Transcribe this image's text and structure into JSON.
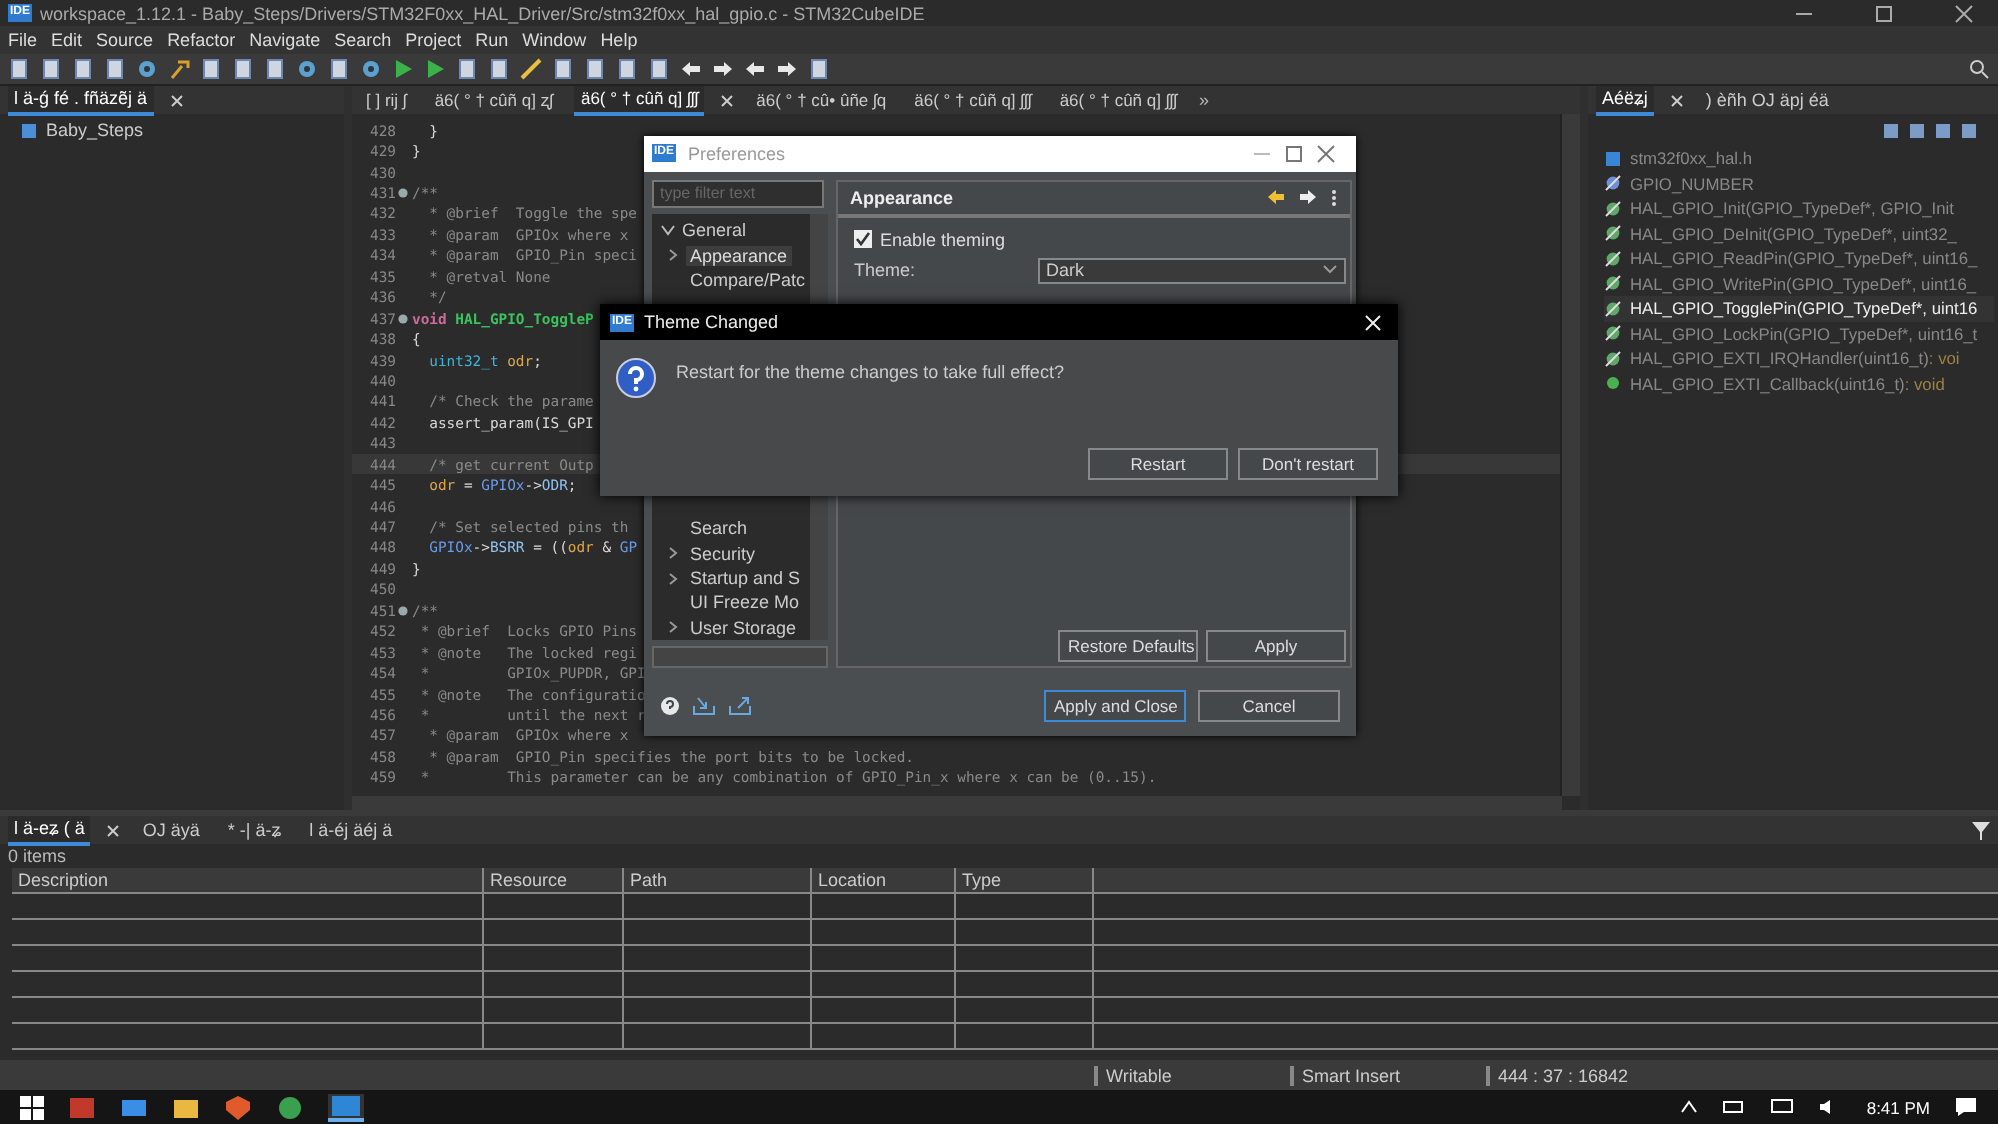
{
  "window": {
    "logo": "IDE",
    "title": "workspace_1.12.1 - Baby_Steps/Drivers/STM32F0xx_HAL_Driver/Src/stm32f0xx_hal_gpio.c - STM32CubeIDE"
  },
  "menu": [
    "File",
    "Edit",
    "Source",
    "Refactor",
    "Navigate",
    "Search",
    "Project",
    "Run",
    "Window",
    "Help"
  ],
  "left_panel": {
    "tabs": [
      {
        "label": "l ä-ǵ fé . fñäzẽj ä",
        "selected": true
      }
    ],
    "items": [
      {
        "label": "Baby_Steps"
      }
    ]
  },
  "editor": {
    "tabs": [
      {
        "label": "[ ] rĳ ʃ",
        "selected": false
      },
      {
        "label": "ä6( ° † cûñ q] ʐʃ",
        "selected": false
      },
      {
        "label": "ä6( ° † cûñ q] ʃʃʃ",
        "selected": true
      },
      {
        "label": "ä6( ° † cû• ûñe ʃq",
        "selected": false
      },
      {
        "label": "ä6( ° † cûñ q] ʃʃʃ",
        "selected": false
      },
      {
        "label": "ä6( ° † cûñ q] ʃʃʃ",
        "selected": false
      }
    ],
    "overflow": "»",
    "lines": [
      {
        "number": "428",
        "fold": false,
        "current": false,
        "segments": [
          {
            "kind": "plain",
            "text": "  }"
          }
        ]
      },
      {
        "number": "429",
        "fold": false,
        "current": false,
        "segments": [
          {
            "kind": "plain",
            "text": "}"
          }
        ]
      },
      {
        "number": "430",
        "fold": false,
        "current": false
      },
      {
        "number": "431",
        "fold": true,
        "current": false,
        "segments": [
          {
            "kind": "comment",
            "text": "/**"
          }
        ]
      },
      {
        "number": "432",
        "fold": false,
        "current": false,
        "segments": [
          {
            "kind": "comment",
            "text": "  * @brief  Toggle the spe"
          }
        ]
      },
      {
        "number": "433",
        "fold": false,
        "current": false,
        "segments": [
          {
            "kind": "comment",
            "text": "  * @param  GPIOx where x"
          }
        ]
      },
      {
        "number": "434",
        "fold": false,
        "current": false,
        "segments": [
          {
            "kind": "comment",
            "text": "  * @param  GPIO_Pin speci"
          }
        ]
      },
      {
        "number": "435",
        "fold": false,
        "current": false,
        "segments": [
          {
            "kind": "comment",
            "text": "  * @retval None"
          }
        ]
      },
      {
        "number": "436",
        "fold": false,
        "current": false,
        "segments": [
          {
            "kind": "comment",
            "text": "  */"
          }
        ]
      },
      {
        "number": "437",
        "fold": true,
        "current": false,
        "segments": [
          {
            "kind": "keyword",
            "text": "void"
          },
          {
            "kind": "function",
            "text": " HAL_GPIO_ToggleP"
          }
        ]
      },
      {
        "number": "438",
        "fold": false,
        "current": false,
        "segments": [
          {
            "kind": "plain",
            "text": "{"
          }
        ]
      },
      {
        "number": "439",
        "fold": false,
        "current": false,
        "segments": [
          {
            "kind": "type",
            "text": "  uint32_t"
          },
          {
            "kind": "variable",
            "text": " odr"
          },
          {
            "kind": "plain",
            "text": ";"
          }
        ]
      },
      {
        "number": "440",
        "fold": false,
        "current": false
      },
      {
        "number": "441",
        "fold": false,
        "current": false,
        "segments": [
          {
            "kind": "comment",
            "text": "  /* Check the parame"
          }
        ]
      },
      {
        "number": "442",
        "fold": false,
        "current": false,
        "segments": [
          {
            "kind": "plain",
            "text": "  assert_param(IS_GPI"
          }
        ]
      },
      {
        "number": "443",
        "fold": false,
        "current": false
      },
      {
        "number": "444",
        "fold": false,
        "current": true,
        "segments": [
          {
            "kind": "comment",
            "text": "  /* get current Outp"
          }
        ]
      },
      {
        "number": "445",
        "fold": false,
        "current": false,
        "segments": [
          {
            "kind": "variable",
            "text": "  odr"
          },
          {
            "kind": "plain",
            "text": " = "
          },
          {
            "kind": "param",
            "text": "GPIOx"
          },
          {
            "kind": "plain",
            "text": "->"
          },
          {
            "kind": "field",
            "text": "ODR"
          },
          {
            "kind": "plain",
            "text": ";"
          }
        ]
      },
      {
        "number": "446",
        "fold": false,
        "current": false
      },
      {
        "number": "447",
        "fold": false,
        "current": false,
        "segments": [
          {
            "kind": "comment",
            "text": "  /* Set selected pins th"
          }
        ]
      },
      {
        "number": "448",
        "fold": false,
        "current": false,
        "segments": [
          {
            "kind": "param",
            "text": "  GPIOx"
          },
          {
            "kind": "plain",
            "text": "->"
          },
          {
            "kind": "field",
            "text": "BSRR"
          },
          {
            "kind": "plain",
            "text": " = (("
          },
          {
            "kind": "variable",
            "text": "odr"
          },
          {
            "kind": "plain",
            "text": " & "
          },
          {
            "kind": "param",
            "text": "GP"
          }
        ]
      },
      {
        "number": "449",
        "fold": false,
        "current": false,
        "segments": [
          {
            "kind": "plain",
            "text": "}"
          }
        ]
      },
      {
        "number": "450",
        "fold": false,
        "current": false
      },
      {
        "number": "451",
        "fold": true,
        "current": false,
        "segments": [
          {
            "kind": "comment",
            "text": "/**"
          }
        ]
      },
      {
        "number": "452",
        "fold": false,
        "current": false,
        "segments": [
          {
            "kind": "comment",
            "text": " * @brief  Locks GPIO Pins"
          }
        ]
      },
      {
        "number": "453",
        "fold": false,
        "current": false,
        "segments": [
          {
            "kind": "comment",
            "text": " * @note   The locked regi"
          }
        ]
      },
      {
        "number": "454",
        "fold": false,
        "current": false,
        "segments": [
          {
            "kind": "comment",
            "text": " *         GPIOx_PUPDR, GPI"
          }
        ]
      },
      {
        "number": "455",
        "fold": false,
        "current": false,
        "segments": [
          {
            "kind": "comment",
            "text": " * @note   The configuratio"
          }
        ]
      },
      {
        "number": "456",
        "fold": false,
        "current": false,
        "segments": [
          {
            "kind": "comment",
            "text": " *         until the next r"
          }
        ]
      },
      {
        "number": "457",
        "fold": false,
        "current": false,
        "segments": [
          {
            "kind": "comment",
            "text": "  * @param  GPIOx where x"
          }
        ]
      },
      {
        "number": "458",
        "fold": false,
        "current": false,
        "segments": [
          {
            "kind": "comment",
            "text": "  * @param  GPIO_Pin specifies the port bits to be locked."
          }
        ]
      },
      {
        "number": "459",
        "fold": false,
        "current": false,
        "segments": [
          {
            "kind": "comment",
            "text": " *         This parameter can be any combination of GPIO_Pin_x where x can be (0..15)."
          }
        ]
      }
    ]
  },
  "outline": {
    "tabs": [
      {
        "label": "Aéëʑj",
        "selected": true
      },
      {
        "label": ") èñh OJ äpj éä",
        "selected": false
      }
    ],
    "items": [
      {
        "kind": "include",
        "label": "stm32f0xx_hal.h",
        "selected": false
      },
      {
        "kind": "macro",
        "label": "GPIO_NUMBER",
        "selected": false
      },
      {
        "kind": "function",
        "label": "HAL_GPIO_Init(GPIO_TypeDef*, GPIO_Init",
        "selected": false
      },
      {
        "kind": "function",
        "label": "HAL_GPIO_DeInit(GPIO_TypeDef*, uint32_",
        "selected": false
      },
      {
        "kind": "function",
        "label": "HAL_GPIO_ReadPin(GPIO_TypeDef*, uint16_",
        "selected": false
      },
      {
        "kind": "function",
        "label": "HAL_GPIO_WritePin(GPIO_TypeDef*, uint16_",
        "selected": false
      },
      {
        "kind": "function",
        "label": "HAL_GPIO_TogglePin(GPIO_TypeDef*, uint16",
        "selected": true
      },
      {
        "kind": "function",
        "label": "HAL_GPIO_LockPin(GPIO_TypeDef*, uint16_t",
        "selected": false
      },
      {
        "kind": "function",
        "label": "HAL_GPIO_EXTI_IRQHandler(uint16_t)",
        "return_type": ": voi",
        "selected": false
      },
      {
        "kind": "public",
        "label": "HAL_GPIO_EXTI_Callback(uint16_t)",
        "return_type": ": void",
        "selected": false
      }
    ]
  },
  "bottom_panel": {
    "tabs": [
      {
        "label": "l ä-eʑ ( ä",
        "selected": true
      },
      {
        "label": "OJ äyä",
        "selected": false
      },
      {
        "label": "* -| ä-ʑ",
        "selected": false
      },
      {
        "label": "l ä-éj äéj ä",
        "selected": false
      }
    ],
    "count": "0 items",
    "columns": [
      "Description",
      "Resource",
      "Path",
      "Location",
      "Type"
    ]
  },
  "status_bar": [
    "Writable",
    "Smart Insert",
    "444 : 37 : 16842"
  ],
  "preferences": {
    "logo": "IDE",
    "title": "Preferences",
    "filter_placeholder": "type filter text",
    "tree": [
      {
        "label": "General",
        "expanded": true,
        "children": [
          {
            "label": "Appearance",
            "selected": true,
            "expandable": true
          },
          {
            "label": "Compare/Patc",
            "selected": false,
            "expandable": false
          },
          {
            "label": "Search",
            "selected": false,
            "expandable": false
          },
          {
            "label": "Security",
            "selected": false,
            "expandable": true
          },
          {
            "label": "Startup and S",
            "selected": false,
            "expandable": true
          },
          {
            "label": "UI Freeze Mo",
            "selected": false,
            "expandable": false
          },
          {
            "label": "User Storage",
            "selected": false,
            "expandable": true
          }
        ]
      }
    ],
    "page_title": "Appearance",
    "enable_theming": {
      "label": "Enable theming",
      "checked": true
    },
    "fields": [
      {
        "label": "Theme:",
        "value": "Dark"
      }
    ],
    "page_buttons": [
      "Restore Defaults",
      "Apply"
    ],
    "footer_buttons": [
      {
        "label": "Apply and Close",
        "default": true
      },
      {
        "label": "Cancel",
        "default": false
      }
    ]
  },
  "theme_dialog": {
    "logo": "IDE",
    "title": "Theme Changed",
    "message": "Restart for the theme changes to take full effect?",
    "buttons": [
      "Restart",
      "Don't restart"
    ]
  },
  "taskbar": {
    "time": "8:41 PM"
  }
}
